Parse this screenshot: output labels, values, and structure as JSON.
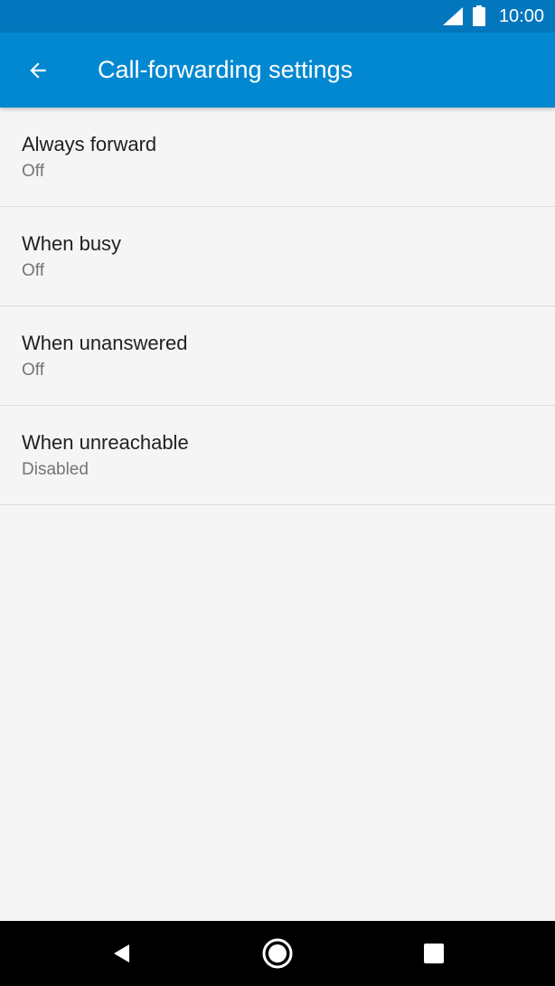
{
  "status_bar": {
    "time": "10:00",
    "icons": [
      "signal-icon",
      "battery-icon"
    ]
  },
  "app_bar": {
    "back_icon": "arrow-back-icon",
    "title": "Call-forwarding settings"
  },
  "settings": {
    "items": [
      {
        "title": "Always forward",
        "summary": "Off"
      },
      {
        "title": "When busy",
        "summary": "Off"
      },
      {
        "title": "When unanswered",
        "summary": "Off"
      },
      {
        "title": "When unreachable",
        "summary": "Disabled"
      }
    ]
  },
  "nav_bar": {
    "buttons": [
      "back-triangle-icon",
      "home-circle-icon",
      "recents-square-icon"
    ]
  },
  "colors": {
    "status_bar": "#0277bd",
    "app_bar": "#0288d1",
    "background": "#f5f5f5",
    "nav_bar": "#000000"
  }
}
